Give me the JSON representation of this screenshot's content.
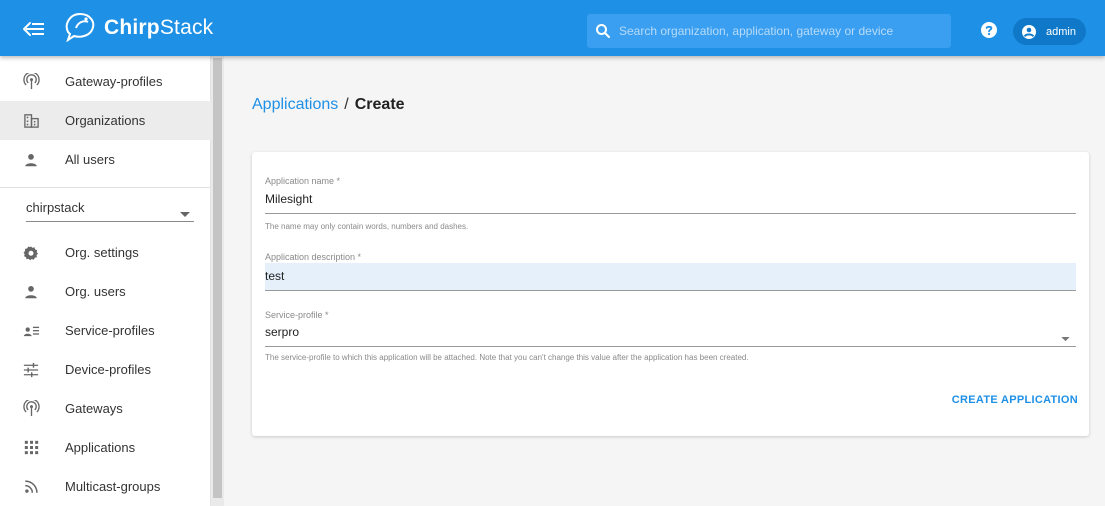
{
  "header": {
    "brand_bold": "Chirp",
    "brand_light": "Stack",
    "search_placeholder": "Search organization, application, gateway or device",
    "username": "admin"
  },
  "sidebar": {
    "top_items": [
      {
        "label": "Gateway-profiles",
        "icon": "radio-tower-icon"
      },
      {
        "label": "Organizations",
        "icon": "domain-icon",
        "active": true
      },
      {
        "label": "All users",
        "icon": "account-icon"
      }
    ],
    "org_selector": {
      "value": "chirpstack"
    },
    "org_items": [
      {
        "label": "Org. settings",
        "icon": "gear-icon"
      },
      {
        "label": "Org. users",
        "icon": "account-icon"
      },
      {
        "label": "Service-profiles",
        "icon": "account-details-icon"
      },
      {
        "label": "Device-profiles",
        "icon": "tune-icon"
      },
      {
        "label": "Gateways",
        "icon": "radio-tower-icon"
      },
      {
        "label": "Applications",
        "icon": "apps-icon"
      },
      {
        "label": "Multicast-groups",
        "icon": "rss-icon"
      }
    ]
  },
  "breadcrumb": {
    "parent": "Applications",
    "separator": "/",
    "current": "Create"
  },
  "form": {
    "name": {
      "label": "Application name *",
      "value": "Milesight",
      "helper": "The name may only contain words, numbers and dashes."
    },
    "description": {
      "label": "Application description *",
      "value": "test"
    },
    "service_profile": {
      "label": "Service-profile *",
      "value": "serpro",
      "helper": "The service-profile to which this application will be attached. Note that you can't change this value after the application has been created."
    },
    "submit_label": "CREATE APPLICATION"
  },
  "colors": {
    "primary": "#1e90e6",
    "sidebar_active": "#ececec",
    "background": "#f5f5f5"
  }
}
